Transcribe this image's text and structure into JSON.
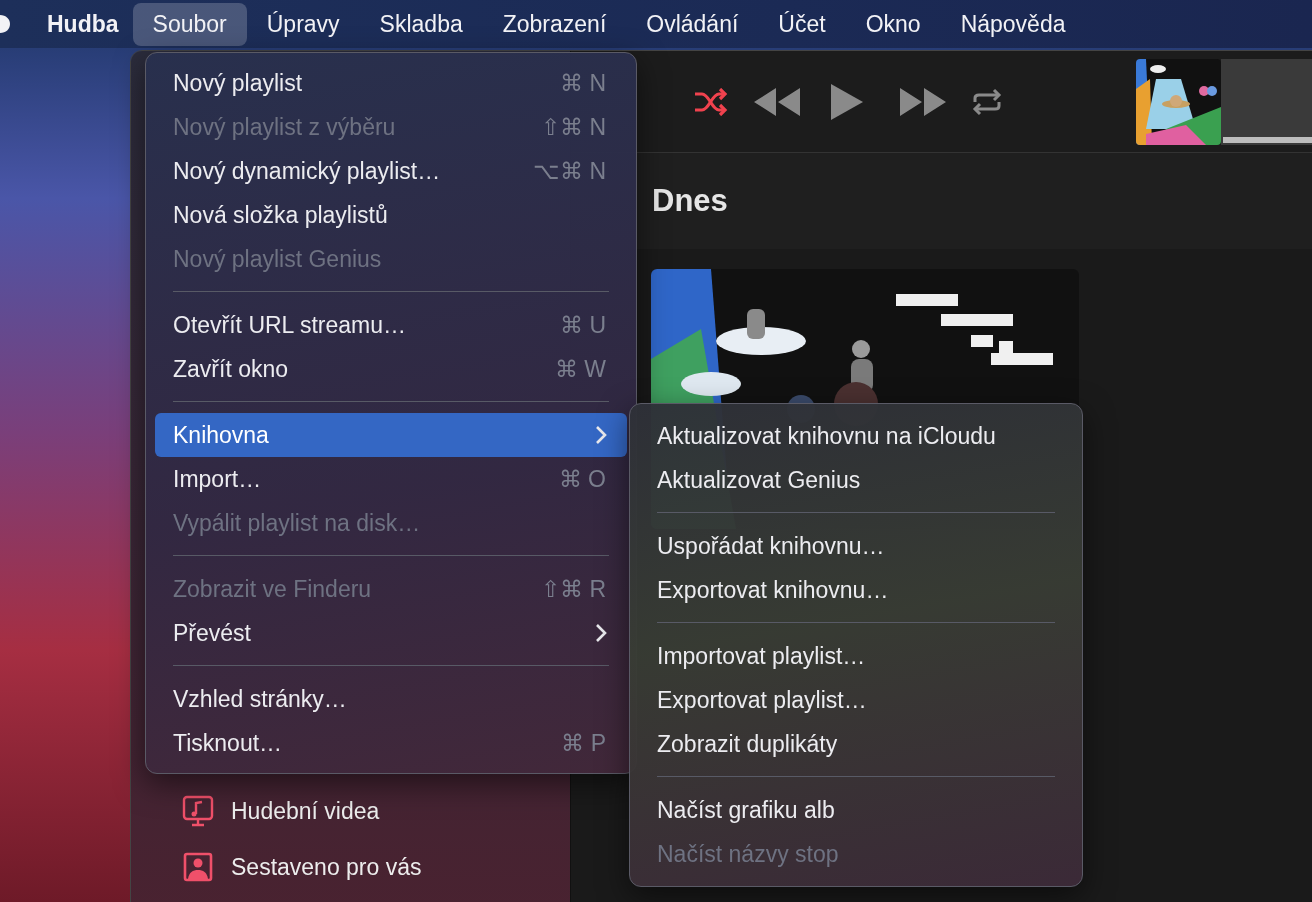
{
  "menu_bar": {
    "items": [
      {
        "label": "Hudba",
        "kind": "app",
        "selected": false
      },
      {
        "label": "Soubor",
        "kind": "menu",
        "selected": true
      },
      {
        "label": "Úpravy",
        "kind": "menu",
        "selected": false
      },
      {
        "label": "Skladba",
        "kind": "menu",
        "selected": false
      },
      {
        "label": "Zobrazení",
        "kind": "menu",
        "selected": false
      },
      {
        "label": "Ovládání",
        "kind": "menu",
        "selected": false
      },
      {
        "label": "Účet",
        "kind": "menu",
        "selected": false
      },
      {
        "label": "Okno",
        "kind": "menu",
        "selected": false
      },
      {
        "label": "Nápověda",
        "kind": "menu",
        "selected": false
      }
    ]
  },
  "player": {
    "shuffle": {
      "on": true
    },
    "repeat": {
      "on": false
    }
  },
  "main": {
    "heading": "Dnes"
  },
  "sidebar": {
    "items": [
      {
        "label": "Hudební videa",
        "kind": "video"
      },
      {
        "label": "Sestaveno pro vás",
        "kind": "person"
      }
    ]
  },
  "file_menu": {
    "groups": [
      [
        {
          "label": "Nový playlist",
          "shortcut": "⌘ N",
          "disabled": false,
          "selected": false,
          "submenu": false
        },
        {
          "label": "Nový playlist z výběru",
          "shortcut": "⇧⌘ N",
          "disabled": true,
          "selected": false,
          "submenu": false
        },
        {
          "label": "Nový dynamický playlist…",
          "shortcut": "⌥⌘ N",
          "disabled": false,
          "selected": false,
          "submenu": false
        },
        {
          "label": "Nová složka playlistů",
          "disabled": false,
          "selected": false,
          "submenu": false
        },
        {
          "label": "Nový playlist Genius",
          "disabled": true,
          "selected": false,
          "submenu": false
        }
      ],
      [
        {
          "label": "Otevřít URL streamu…",
          "shortcut": "⌘ U",
          "disabled": false,
          "selected": false,
          "submenu": false
        },
        {
          "label": "Zavřít okno",
          "shortcut": "⌘ W",
          "disabled": false,
          "selected": false,
          "submenu": false
        }
      ],
      [
        {
          "label": "Knihovna",
          "disabled": false,
          "selected": true,
          "submenu": true
        },
        {
          "label": "Import…",
          "shortcut": "⌘ O",
          "disabled": false,
          "selected": false,
          "submenu": false
        },
        {
          "label": "Vypálit playlist na disk…",
          "disabled": true,
          "selected": false,
          "submenu": false
        }
      ],
      [
        {
          "label": "Zobrazit ve Finderu",
          "shortcut": "⇧⌘ R",
          "disabled": true,
          "selected": false,
          "submenu": false
        },
        {
          "label": "Převést",
          "disabled": false,
          "selected": false,
          "submenu": true
        }
      ],
      [
        {
          "label": "Vzhled stránky…",
          "disabled": false,
          "selected": false,
          "submenu": false
        },
        {
          "label": "Tisknout…",
          "shortcut": "⌘ P",
          "disabled": false,
          "selected": false,
          "submenu": false
        }
      ]
    ]
  },
  "library_submenu": {
    "groups": [
      [
        {
          "label": "Aktualizovat knihovnu na iCloudu",
          "disabled": false
        },
        {
          "label": "Aktualizovat Genius",
          "disabled": false
        }
      ],
      [
        {
          "label": "Uspořádat knihovnu…",
          "disabled": false
        },
        {
          "label": "Exportovat knihovnu…",
          "disabled": false
        }
      ],
      [
        {
          "label": "Importovat playlist…",
          "disabled": false
        },
        {
          "label": "Exportovat playlist…",
          "disabled": false
        },
        {
          "label": "Zobrazit duplikáty",
          "disabled": false
        }
      ],
      [
        {
          "label": "Načíst grafiku alb",
          "disabled": false
        },
        {
          "label": "Načíst názvy stop",
          "disabled": true
        }
      ]
    ]
  }
}
